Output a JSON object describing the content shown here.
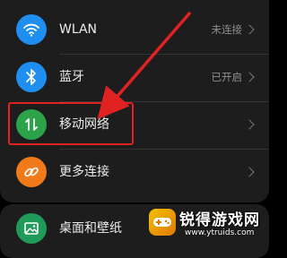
{
  "settings": {
    "items": [
      {
        "icon": "wifi-icon",
        "label": "WLAN",
        "status": "未连接",
        "color": "#1f8ef1"
      },
      {
        "icon": "bluetooth-icon",
        "label": "蓝牙",
        "status": "已开启",
        "color": "#1f8ef1"
      },
      {
        "icon": "mobile-network-icon",
        "label": "移动网络",
        "status": "",
        "color": "#2ca24a"
      },
      {
        "icon": "link-icon",
        "label": "更多连接",
        "status": "",
        "color": "#f07a1a"
      },
      {
        "icon": "wallpaper-icon",
        "label": "桌面和壁纸",
        "status": "",
        "color": "#1f9a58"
      }
    ]
  },
  "annotation": {
    "color": "#e02222"
  },
  "watermark": {
    "title": "锐得游戏网",
    "url": "www.ytruids.com"
  }
}
